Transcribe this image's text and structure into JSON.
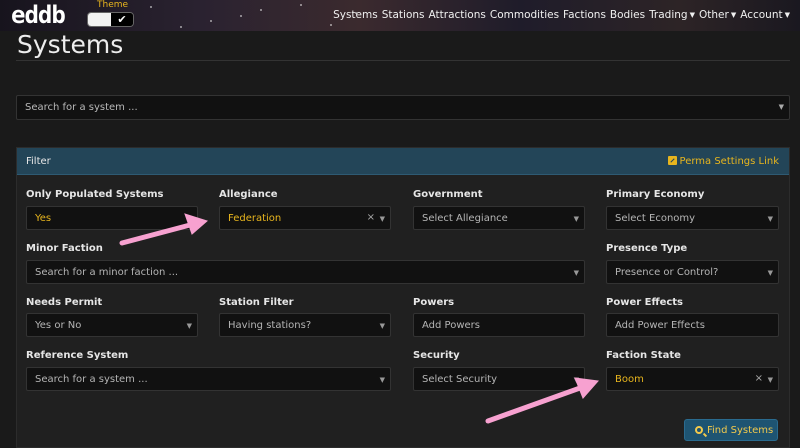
{
  "header": {
    "logo": "eddb",
    "theme_label": "Theme",
    "theme_check": "✔",
    "nav": [
      {
        "label": "Systems",
        "dropdown": false
      },
      {
        "label": "Stations",
        "dropdown": false
      },
      {
        "label": "Attractions",
        "dropdown": false
      },
      {
        "label": "Commodities",
        "dropdown": false
      },
      {
        "label": "Factions",
        "dropdown": false
      },
      {
        "label": "Bodies",
        "dropdown": false
      },
      {
        "label": "Trading",
        "dropdown": true
      },
      {
        "label": "Other",
        "dropdown": true
      },
      {
        "label": "Account",
        "dropdown": true
      }
    ]
  },
  "page": {
    "title": "Systems",
    "search_placeholder": "Search for a system ..."
  },
  "filter": {
    "title": "Filter",
    "perma_link": "Perma Settings Link",
    "fields": {
      "only_populated": {
        "label": "Only Populated Systems",
        "value": "Yes"
      },
      "allegiance": {
        "label": "Allegiance",
        "value": "Federation"
      },
      "government": {
        "label": "Government",
        "placeholder": "Select Allegiance"
      },
      "primary_economy": {
        "label": "Primary Economy",
        "placeholder": "Select Economy"
      },
      "minor_faction": {
        "label": "Minor Faction",
        "placeholder": "Search for a minor faction ..."
      },
      "presence_type": {
        "label": "Presence Type",
        "placeholder": "Presence or Control?"
      },
      "needs_permit": {
        "label": "Needs Permit",
        "placeholder": "Yes or No"
      },
      "station_filter": {
        "label": "Station Filter",
        "placeholder": "Having stations?"
      },
      "powers": {
        "label": "Powers",
        "placeholder": "Add Powers"
      },
      "power_effects": {
        "label": "Power Effects",
        "placeholder": "Add Power Effects"
      },
      "reference_system": {
        "label": "Reference System",
        "placeholder": "Search for a system ..."
      },
      "security": {
        "label": "Security",
        "placeholder": "Select Security"
      },
      "faction_state": {
        "label": "Faction State",
        "value": "Boom"
      }
    },
    "find_button": "Find Systems",
    "clear_glyph": "×",
    "dropdown_glyph": "▼"
  },
  "colors": {
    "accent_yellow": "#e7b51e",
    "panel_header": "#234558",
    "annotation_arrow": "#f7a1d0"
  }
}
